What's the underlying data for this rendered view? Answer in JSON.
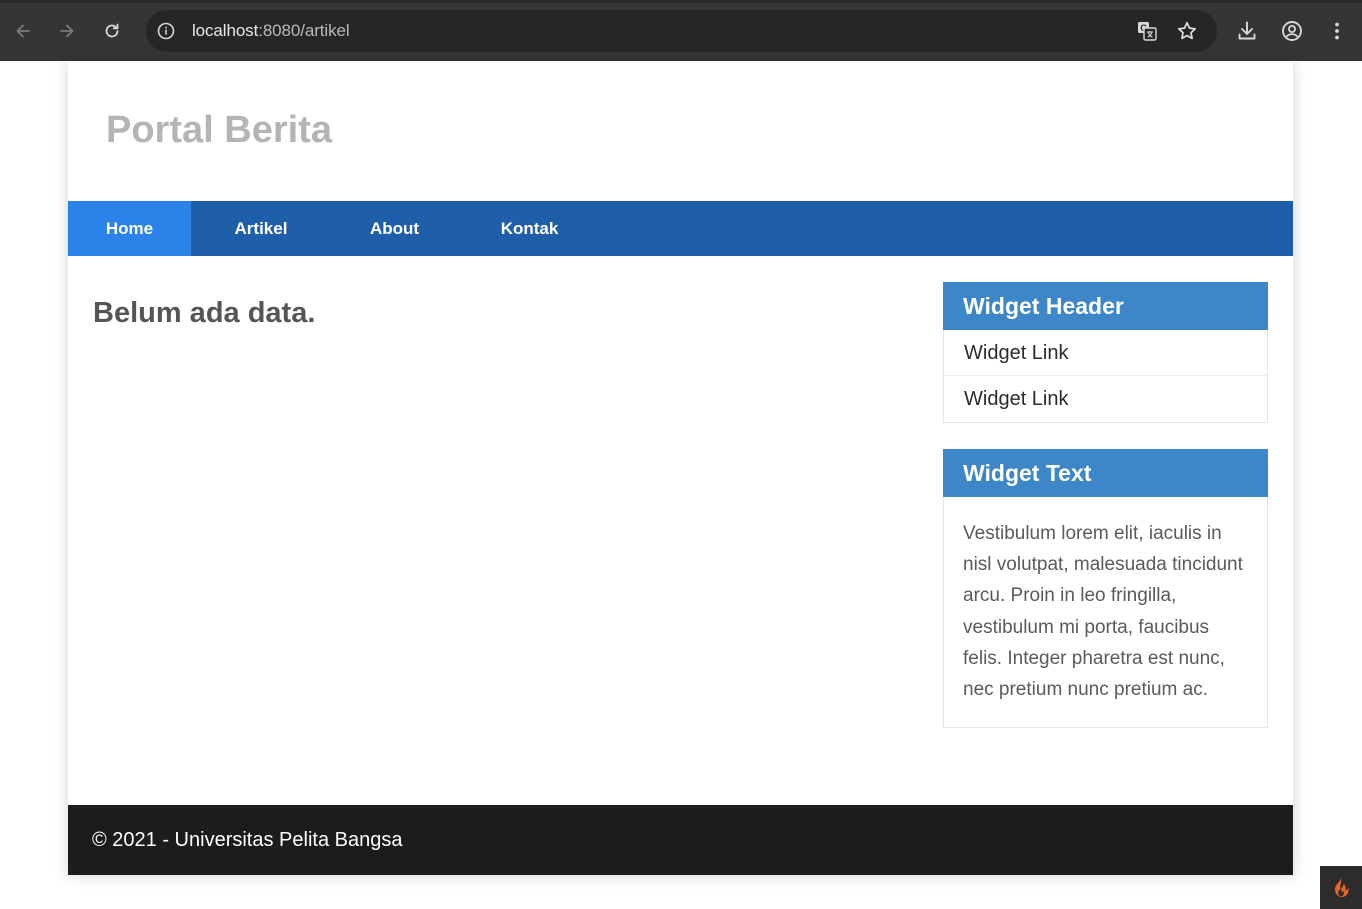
{
  "browser": {
    "url_host": "localhost",
    "url_path": ":8080/artikel",
    "icons": [
      "back-icon",
      "forward-icon",
      "reload-icon",
      "info-icon",
      "translate-icon",
      "bookmark-star-icon",
      "download-icon",
      "profile-icon",
      "menu-icon"
    ]
  },
  "header": {
    "title": "Portal Berita"
  },
  "nav": {
    "items": [
      {
        "label": "Home",
        "active": true
      },
      {
        "label": "Artikel",
        "active": false
      },
      {
        "label": "About",
        "active": false
      },
      {
        "label": "Kontak",
        "active": false
      }
    ]
  },
  "main": {
    "message": "Belum ada data."
  },
  "sidebar": {
    "widget1": {
      "header": "Widget Header",
      "links": [
        "Widget Link",
        "Widget Link"
      ]
    },
    "widget2": {
      "header": "Widget Text",
      "text": "Vestibulum lorem elit, iaculis in nisl volutpat, malesuada tincidunt arcu. Proin in leo fringilla, vestibulum mi porta, faucibus felis. Integer pharetra est nunc, nec pretium nunc pretium ac."
    }
  },
  "footer": {
    "text": "© 2021 - Universitas Pelita Bangsa"
  },
  "colors": {
    "nav": "#1f5faa",
    "nav_active": "#2b83ea",
    "widget_header": "#3d87c8",
    "footer": "#1c1c1c"
  }
}
